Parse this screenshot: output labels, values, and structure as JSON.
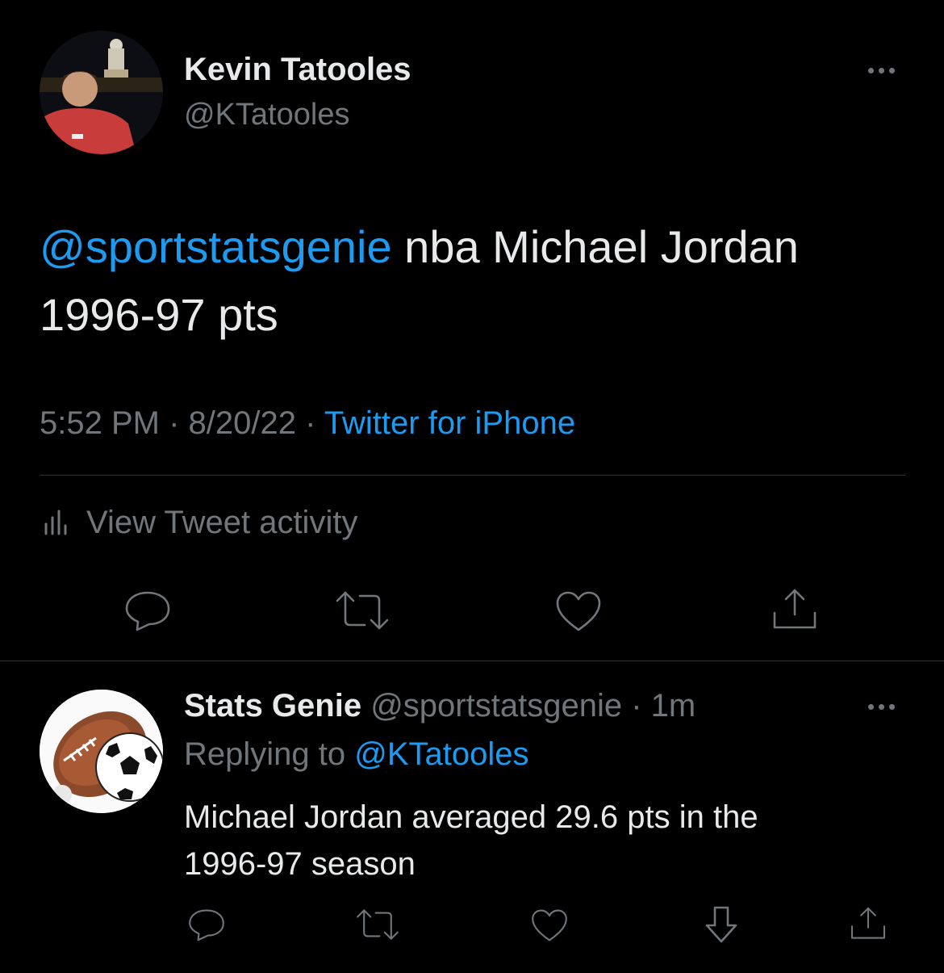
{
  "main_tweet": {
    "author_name": "Kevin Tatooles",
    "author_handle": "@KTatooles",
    "mention": "@sportstatsgenie",
    "text": " nba Michael Jordan 1996-97 pts",
    "time": "5:52 PM",
    "sep1": " · ",
    "date": "8/20/22",
    "sep2": " · ",
    "source": "Twitter for iPhone",
    "activity_label": "View Tweet activity"
  },
  "reply": {
    "author_name": "Stats Genie",
    "author_handle": "@sportstatsgenie",
    "sep": " · ",
    "age": "1m",
    "replying_to_label": "Replying to ",
    "replying_to_handle": "@KTatooles",
    "text": "Michael Jordan averaged 29.6 pts in the 1996-97 season"
  },
  "colors": {
    "background": "#000000",
    "text": "#e7e9ea",
    "secondary": "#71767b",
    "accent": "#1d9bf0",
    "divider": "#2f3336"
  },
  "icons": {
    "main_actions": [
      "reply-icon",
      "retweet-icon",
      "like-icon",
      "share-icon"
    ],
    "reply_actions": [
      "reply-icon",
      "retweet-icon",
      "like-icon",
      "vote-down-icon",
      "share-icon"
    ]
  }
}
